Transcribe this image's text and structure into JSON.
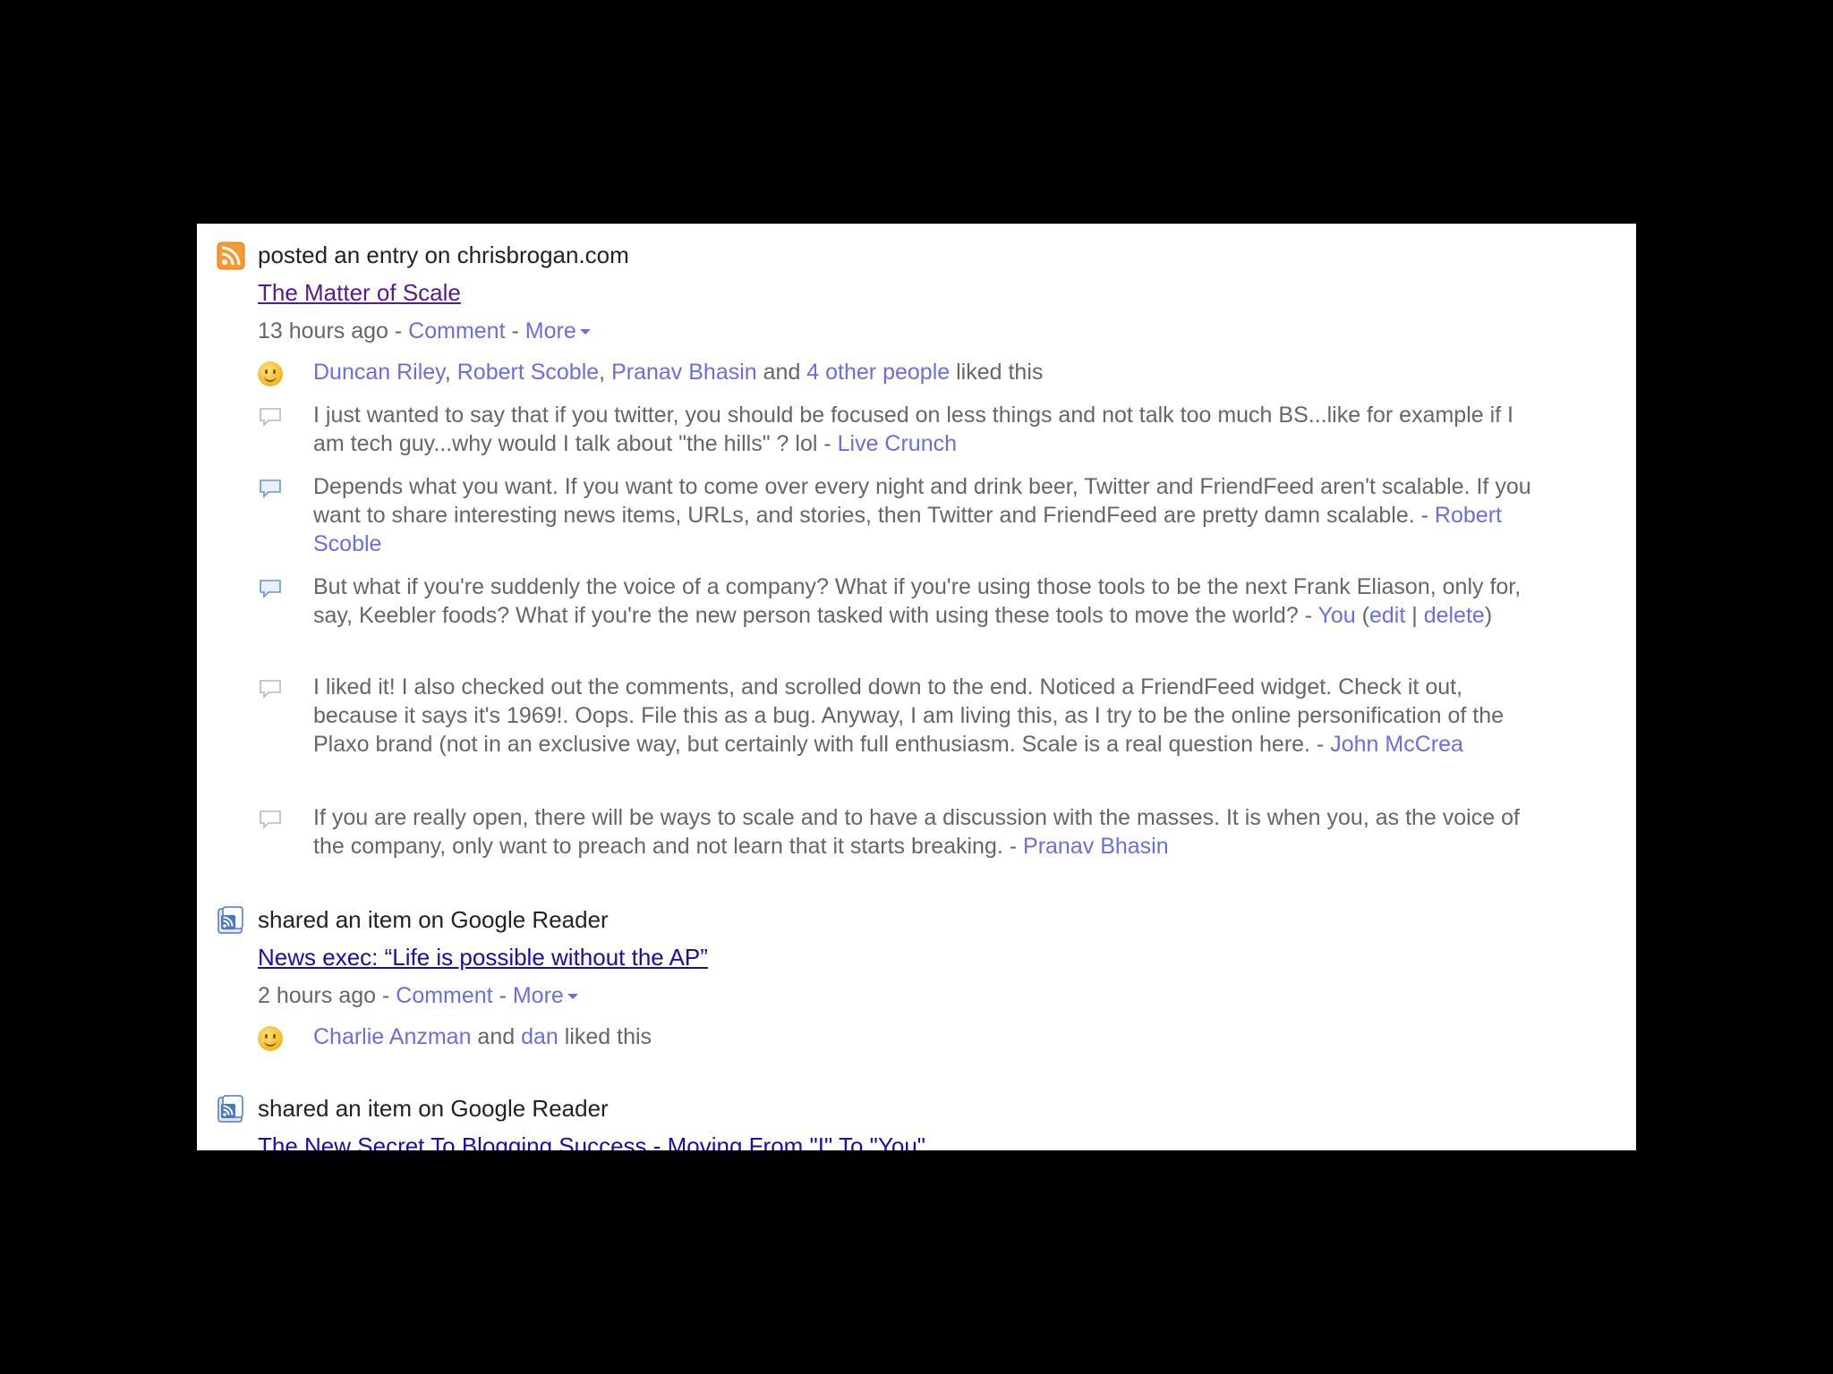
{
  "entries": [
    {
      "action": "posted an entry on chrisbrogan.com",
      "icon": "rss-feed-icon",
      "title": "The Matter of Scale",
      "time": "13 hours ago",
      "sep1": " - ",
      "comment_label": "Comment",
      "sep2": " - ",
      "more_label": "More",
      "likes": {
        "people": [
          "Duncan Riley",
          "Robert Scoble",
          "Pranav Bhasin"
        ],
        "comma": ", ",
        "and": " and ",
        "others": "4 other people",
        "suffix": " liked this"
      },
      "comments": [
        {
          "text": "I just wanted to say that if you twitter, you should be focused on less things and not talk too much BS...like for example if I am tech guy...why would I talk about \"the hills\" ? lol - ",
          "author": "Live Crunch"
        },
        {
          "text": "Depends what you want. If you want to come over every night and drink beer, Twitter and FriendFeed aren't scalable. If you want to share interesting news items, URLs, and stories, then Twitter and FriendFeed are pretty damn scalable. - ",
          "author": "Robert Scoble"
        },
        {
          "text": "But what if you're suddenly the voice of a company? What if you're using those tools to be the next Frank Eliason, only for, say, Keebler foods? What if you're the new person tasked with using these tools to move the world? - ",
          "author": "You",
          "open_paren": " (",
          "edit_label": "edit",
          "pipe": " | ",
          "delete_label": "delete",
          "close_paren": ")"
        },
        {
          "text": "I liked it! I also checked out the comments, and scrolled down to the end. Noticed a FriendFeed widget. Check it out, because it says it's 1969!. Oops. File this as a bug. Anyway, I am living this, as I try to be the online personification of the Plaxo brand (not in an exclusive way, but certainly with full enthusiasm. Scale is a real question here. - ",
          "author": "John McCrea"
        },
        {
          "text": "If you are really open, there will be ways to scale and to have a discussion with the masses. It is when you, as the voice of the company, only want to preach and not learn that it starts breaking. - ",
          "author": "Pranav Bhasin"
        }
      ]
    },
    {
      "action": "shared an item on Google Reader",
      "icon": "google-reader-icon",
      "title": "News exec: “Life is possible without the AP”",
      "time": "2 hours ago",
      "sep1": " - ",
      "comment_label": "Comment",
      "sep2": " - ",
      "more_label": "More",
      "likes": {
        "person1": "Charlie Anzman",
        "and": " and ",
        "person2": "dan",
        "suffix": " liked this"
      }
    },
    {
      "action": "shared an item on Google Reader",
      "icon": "google-reader-icon",
      "title": "The New Secret To Blogging Success - Moving From \"I\" To \"You\""
    }
  ],
  "colors": {
    "link": "#6a6ee0",
    "visited_title": "#551a8b",
    "unvisited_title": "#1a0dab",
    "meta_text": "#666666",
    "rss_orange": "#f79a32",
    "reader_blue": "#4a78c9"
  }
}
